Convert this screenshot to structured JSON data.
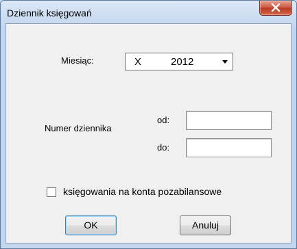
{
  "window": {
    "title": "Dziennik księgowań"
  },
  "month": {
    "label": "Miesiąc:",
    "selected_month": "X",
    "selected_year": "2012"
  },
  "journal": {
    "label": "Numer dziennika",
    "from_label": "od:",
    "to_label": "do:",
    "from_value": "",
    "to_value": ""
  },
  "off_balance": {
    "label": "księgowania na konta pozabilansowe",
    "checked": false
  },
  "buttons": {
    "ok": "OK",
    "cancel": "Anuluj"
  }
}
